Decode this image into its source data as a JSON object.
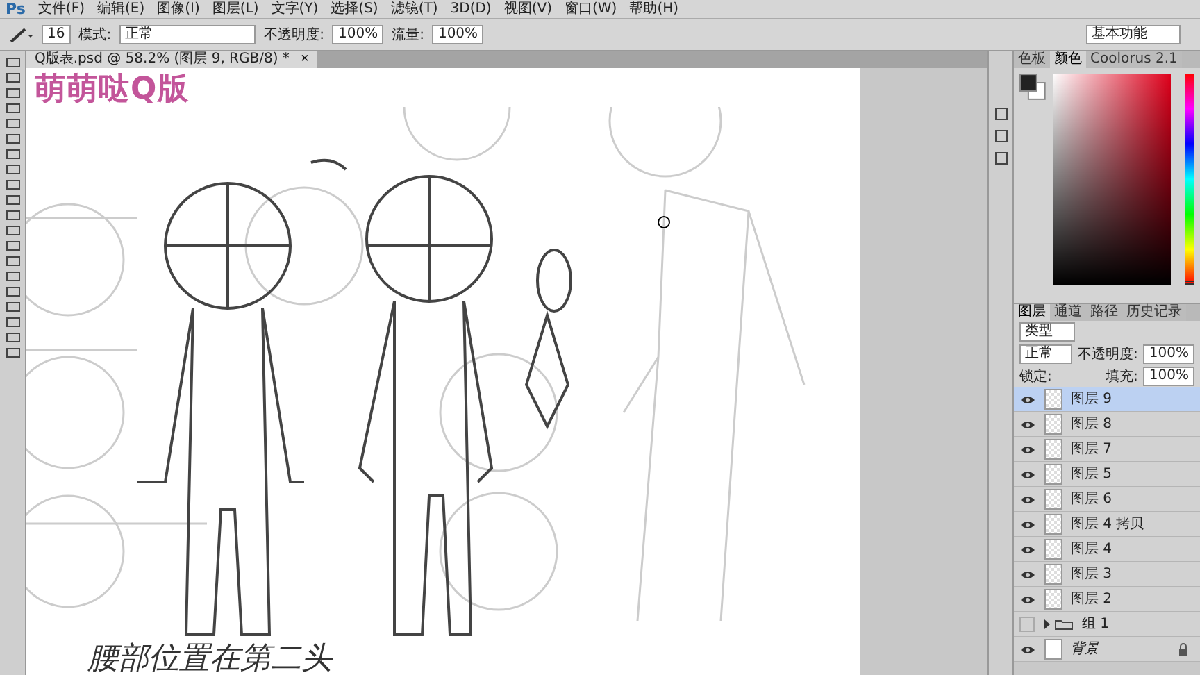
{
  "app_logo": "Ps",
  "hue_slider": {
    "level": 0
  },
  "menu": [
    "文件(F)",
    "编辑(E)",
    "图像(I)",
    "图层(L)",
    "文字(Y)",
    "选择(S)",
    "滤镜(T)",
    "3D(D)",
    "视图(V)",
    "窗口(W)",
    "帮助(H)"
  ],
  "options": {
    "brush_size": "16",
    "mode_label": "模式:",
    "mode": "正常",
    "opacity_label": "不透明度:",
    "opacity": "100%",
    "flow_label": "流量:",
    "flow": "100%"
  },
  "workspace": "基本功能",
  "document_tab": {
    "title": "Q版表.psd @ 58.2% (图层 9, RGB/8) *",
    "close": "×"
  },
  "canvas": {
    "title": "萌萌哒Q版",
    "note": "腰部位置在第二头"
  },
  "color_panel": {
    "tabs": [
      {
        "label": "色板",
        "selected": false
      },
      {
        "label": "颜色",
        "selected": true
      },
      {
        "label": "Coolorus 2.1",
        "selected": false
      }
    ]
  },
  "layers_panel": {
    "tabs": [
      {
        "label": "图层",
        "selected": true
      },
      {
        "label": "通道",
        "selected": false
      },
      {
        "label": "路径",
        "selected": false
      },
      {
        "label": "历史记录",
        "selected": false
      }
    ],
    "filter": "类型",
    "blend": "正常",
    "opacity_label": "不透明度:",
    "opacity": "100%",
    "lock_label": "锁定:",
    "fill_label": "填充:",
    "fill": "100%",
    "layers": [
      {
        "kind": "layer",
        "name": "图层 9",
        "visible": true,
        "selected": true
      },
      {
        "kind": "layer",
        "name": "图层 8",
        "visible": true,
        "selected": false
      },
      {
        "kind": "layer",
        "name": "图层 7",
        "visible": true,
        "selected": false
      },
      {
        "kind": "layer",
        "name": "图层 5",
        "visible": true,
        "selected": false
      },
      {
        "kind": "layer",
        "name": "图层 6",
        "visible": true,
        "selected": false
      },
      {
        "kind": "layer",
        "name": "图层 4 拷贝",
        "visible": true,
        "selected": false
      },
      {
        "kind": "layer",
        "name": "图层 4",
        "visible": true,
        "selected": false
      },
      {
        "kind": "layer",
        "name": "图层 3",
        "visible": true,
        "selected": false
      },
      {
        "kind": "layer",
        "name": "图层 2",
        "visible": true,
        "selected": false
      },
      {
        "kind": "group",
        "name": "组 1",
        "visible": false,
        "selected": false
      },
      {
        "kind": "background",
        "name": "背景",
        "visible": true,
        "selected": false
      }
    ]
  }
}
